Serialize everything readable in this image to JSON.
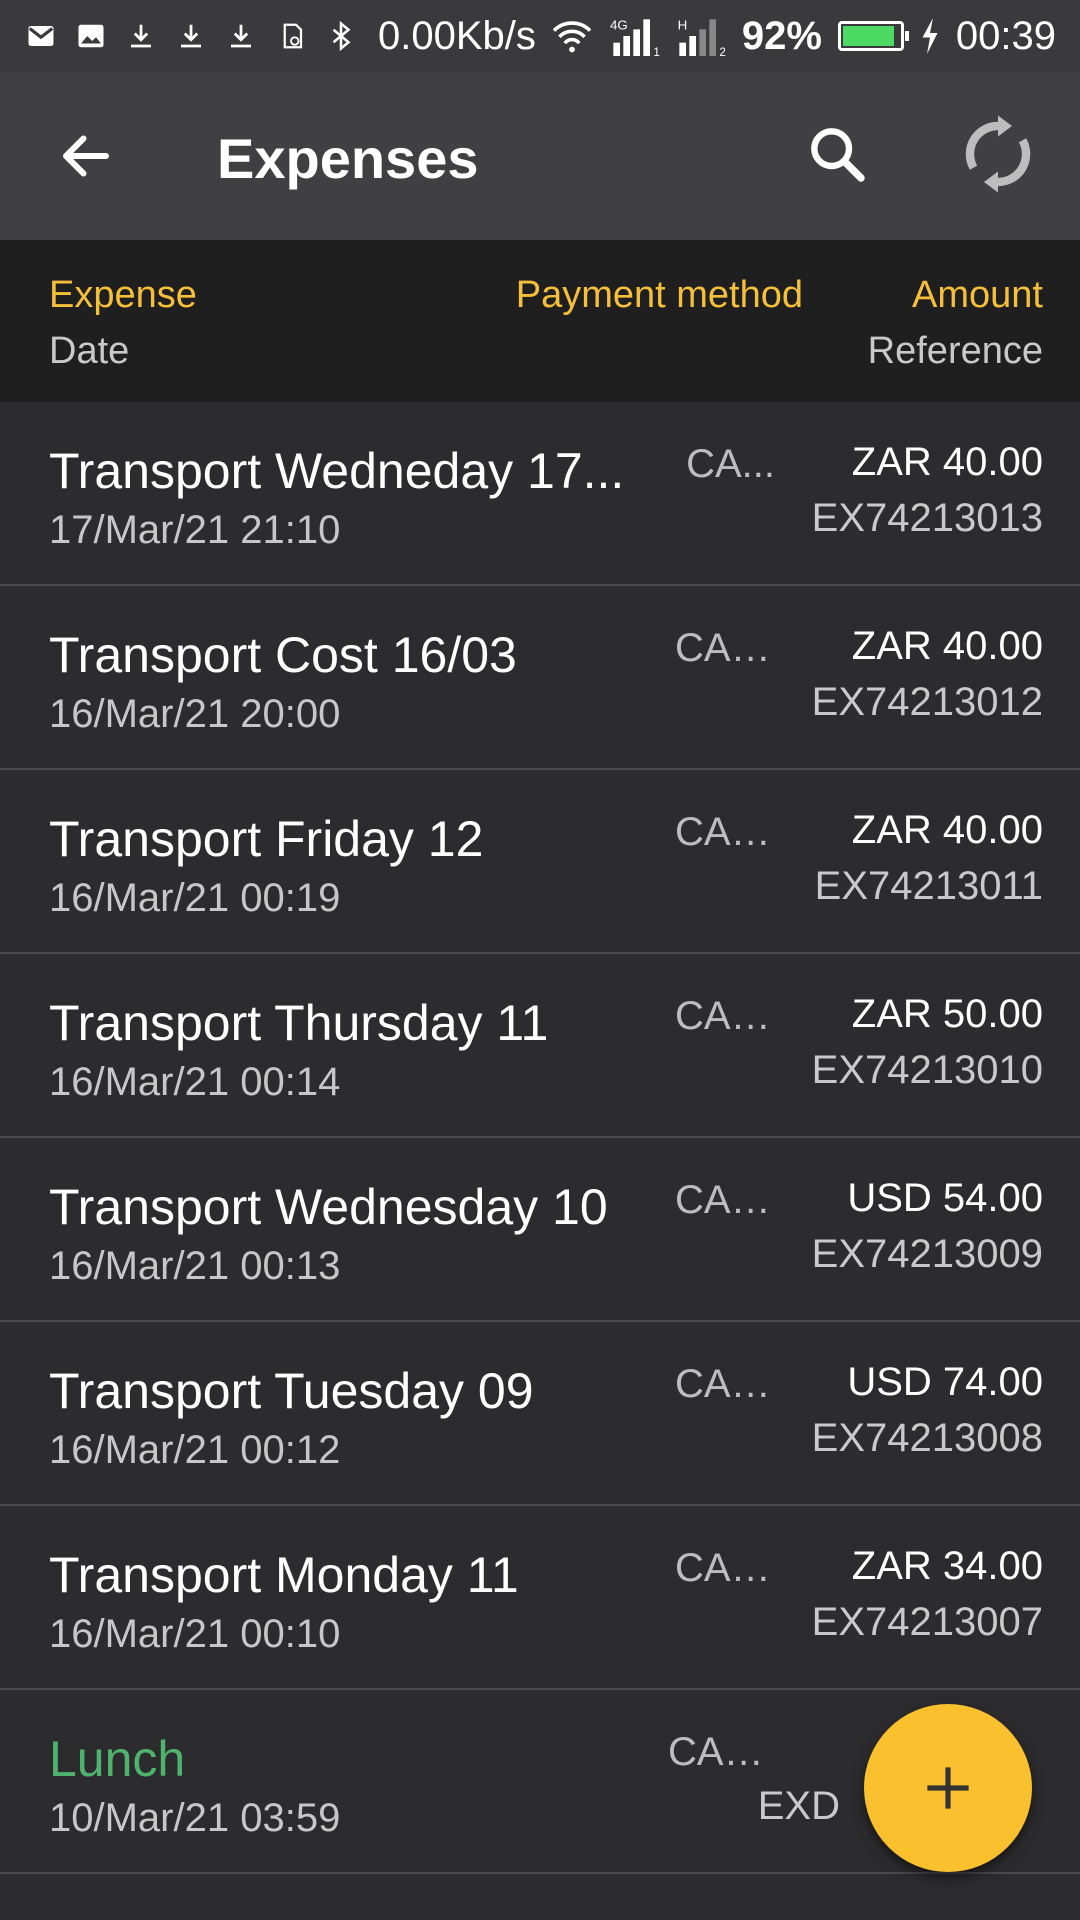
{
  "status": {
    "speed": "0.00Kb/s",
    "network_4g": "4G",
    "sim1": "1",
    "network_h": "H",
    "sim2": "2",
    "battery": "92%",
    "battery_level": 0.92,
    "time": "00:39",
    "icons": [
      "gmail-icon",
      "image-icon",
      "download-icon",
      "download-icon",
      "download-icon",
      "sd-card-icon",
      "bluetooth-icon",
      "wifi-icon",
      "signal-icon",
      "signal-icon",
      "charging-icon"
    ]
  },
  "appbar": {
    "title": "Expenses",
    "back_icon": "arrow-left-icon",
    "search_icon": "search-icon",
    "sync_icon": "sync-icon"
  },
  "header": {
    "expense": "Expense",
    "date": "Date",
    "payment_method": "Payment method",
    "amount": "Amount",
    "reference": "Reference"
  },
  "rows": [
    {
      "name": "Transport Wedneday 17...",
      "date": "17/Mar/21 21:10",
      "method": "CA...",
      "amount": "ZAR 40.00",
      "ref": "EX74213013"
    },
    {
      "name": "Transport Cost 16/03",
      "date": "16/Mar/21 20:00",
      "method": "CASH",
      "amount": "ZAR 40.00",
      "ref": "EX74213012"
    },
    {
      "name": "Transport Friday 12",
      "date": "16/Mar/21 00:19",
      "method": "CASH",
      "amount": "ZAR 40.00",
      "ref": "EX74213011"
    },
    {
      "name": "Transport Thursday 11",
      "date": "16/Mar/21 00:14",
      "method": "CASH",
      "amount": "ZAR 50.00",
      "ref": "EX74213010"
    },
    {
      "name": "Transport  Wednesday 10",
      "date": "16/Mar/21 00:13",
      "method": "CASH",
      "amount": "USD 54.00",
      "ref": "EX74213009"
    },
    {
      "name": "Transport Tuesday 09",
      "date": "16/Mar/21 00:12",
      "method": "CASH",
      "amount": "USD 74.00",
      "ref": "EX74213008"
    },
    {
      "name": "Transport Monday 11",
      "date": "16/Mar/21 00:10",
      "method": "CASH",
      "amount": "ZAR 34.00",
      "ref": "EX74213007"
    },
    {
      "name": "Lunch",
      "date": "10/Mar/21 03:59",
      "method": "CASH",
      "amount": "",
      "ref": "EXD"
    }
  ],
  "fab": {
    "icon": "plus-icon"
  },
  "colors": {
    "accent": "#f6bf3a",
    "fab": "#fbc02d",
    "green": "#4fb36e"
  }
}
